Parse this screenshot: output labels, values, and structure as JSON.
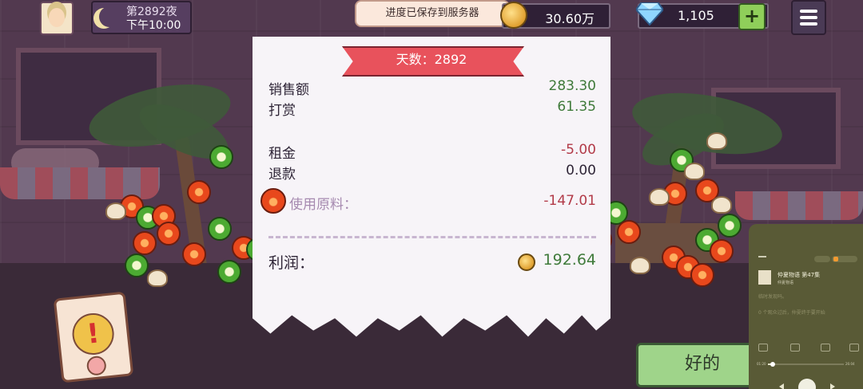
{
  "colors": {
    "profit_green": "#3f7a3a",
    "cost_red": "#b23a48",
    "ribbon_red": "#e8525c",
    "ok_green": "#9fd48a"
  },
  "top_bar": {
    "night_label": "第2892夜",
    "time": "下午10:00",
    "save_toast": "进度已保存到服务器",
    "coins": "30.60万",
    "gems": "1,105",
    "add_label": "+",
    "icons": [
      "avatar",
      "moon-icon",
      "coin-icon",
      "diamond-icon",
      "plus-icon",
      "menu-icon"
    ]
  },
  "receipt": {
    "day_banner": "天数：2892",
    "rows": [
      {
        "label": "销售额",
        "value": "283.30"
      },
      {
        "label": "打赏",
        "value": "61.35"
      },
      {
        "label": "租金",
        "value": "-5.00"
      },
      {
        "label": "退款",
        "value": "0.00"
      },
      {
        "label": "使用原料：",
        "value": "-147.01"
      }
    ],
    "profit_label": "利润：",
    "profit_value": "192.64"
  },
  "ok_button": "好的",
  "media_player": {
    "title": "仲夏物语 第47集",
    "subtitle": "仲夏物语",
    "lyric_1": "临时发现吗。",
    "lyric_2": "0 个观众过后，仲夏终于要开始",
    "time_elapsed": "01:20",
    "time_total": "26:04",
    "progress": 0.06
  }
}
